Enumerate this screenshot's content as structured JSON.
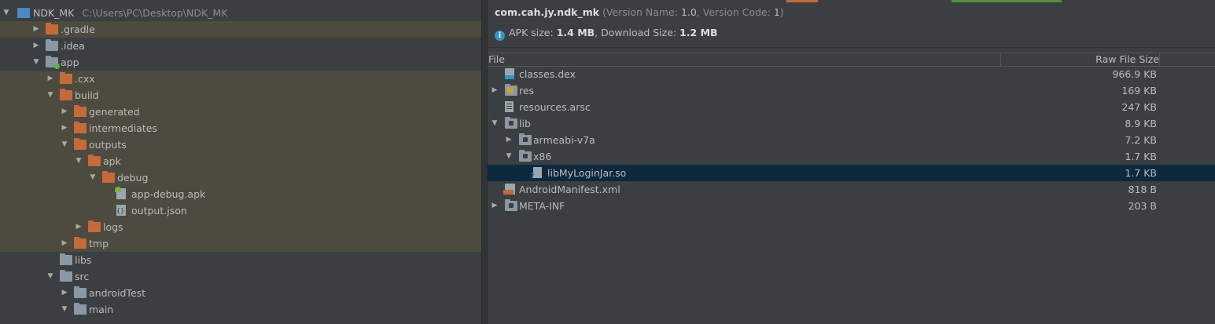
{
  "project_tree": {
    "root": {
      "name": "NDK_MK",
      "path": "C:\\Users\\PC\\Desktop\\NDK_MK"
    },
    "items": [
      {
        "label": ".gradle",
        "depth": 1,
        "arrow": "collapsed",
        "icon": "folder-orange-icon",
        "excluded": true
      },
      {
        "label": ".idea",
        "depth": 1,
        "arrow": "collapsed",
        "icon": "folder-gray-icon",
        "excluded": false
      },
      {
        "label": "app",
        "depth": 1,
        "arrow": "expanded",
        "icon": "module-folder-icon",
        "excluded": false
      },
      {
        "label": ".cxx",
        "depth": 2,
        "arrow": "collapsed",
        "icon": "folder-orange-icon",
        "excluded": true
      },
      {
        "label": "build",
        "depth": 2,
        "arrow": "expanded",
        "icon": "folder-orange-icon",
        "excluded": true
      },
      {
        "label": "generated",
        "depth": 3,
        "arrow": "collapsed",
        "icon": "folder-orange-icon",
        "excluded": true
      },
      {
        "label": "intermediates",
        "depth": 3,
        "arrow": "collapsed",
        "icon": "folder-orange-icon",
        "excluded": true
      },
      {
        "label": "outputs",
        "depth": 3,
        "arrow": "expanded",
        "icon": "folder-orange-icon",
        "excluded": true
      },
      {
        "label": "apk",
        "depth": 4,
        "arrow": "expanded",
        "icon": "folder-orange-icon",
        "excluded": true
      },
      {
        "label": "debug",
        "depth": 5,
        "arrow": "expanded",
        "icon": "folder-orange-icon",
        "excluded": true
      },
      {
        "label": "app-debug.apk",
        "depth": 6,
        "arrow": "none",
        "icon": "apk-file-icon",
        "excluded": true
      },
      {
        "label": "output.json",
        "depth": 6,
        "arrow": "none",
        "icon": "json-file-icon",
        "excluded": true
      },
      {
        "label": "logs",
        "depth": 4,
        "arrow": "collapsed",
        "icon": "folder-orange-icon",
        "excluded": true
      },
      {
        "label": "tmp",
        "depth": 3,
        "arrow": "collapsed",
        "icon": "folder-orange-icon",
        "excluded": true
      },
      {
        "label": "libs",
        "depth": 2,
        "arrow": "none",
        "icon": "folder-gray-icon",
        "excluded": false
      },
      {
        "label": "src",
        "depth": 2,
        "arrow": "expanded",
        "icon": "folder-gray-icon",
        "excluded": false
      },
      {
        "label": "androidTest",
        "depth": 3,
        "arrow": "collapsed",
        "icon": "folder-gray-icon",
        "excluded": false
      },
      {
        "label": "main",
        "depth": 3,
        "arrow": "expanded",
        "icon": "folder-gray-icon",
        "excluded": false
      }
    ]
  },
  "apk_analyzer": {
    "package": "com.cah.jy.ndk_mk",
    "version_name_label": "Version Name:",
    "version_name": "1.0",
    "version_code_label": "Version Code:",
    "version_code": "1",
    "apk_size_label": "APK size:",
    "apk_size": "1.4 MB",
    "download_size_label": "Download Size:",
    "download_size": "1.2 MB",
    "columns": {
      "file": "File",
      "raw_size": "Raw File Size"
    },
    "files": [
      {
        "name": "classes.dex",
        "size": "966.9 KB",
        "depth": 0,
        "arrow": "none",
        "icon": "dex-file-icon",
        "selected": false
      },
      {
        "name": "res",
        "size": "169 KB",
        "depth": 0,
        "arrow": "collapsed",
        "icon": "res-folder-icon",
        "selected": false
      },
      {
        "name": "resources.arsc",
        "size": "247 KB",
        "depth": 0,
        "arrow": "none",
        "icon": "file-icon",
        "selected": false
      },
      {
        "name": "lib",
        "size": "8.9 KB",
        "depth": 0,
        "arrow": "expanded",
        "icon": "lib-folder-icon",
        "selected": false
      },
      {
        "name": "armeabi-v7a",
        "size": "7.2 KB",
        "depth": 1,
        "arrow": "collapsed",
        "icon": "lib-folder-icon",
        "selected": false
      },
      {
        "name": "x86",
        "size": "1.7 KB",
        "depth": 1,
        "arrow": "expanded",
        "icon": "lib-folder-icon",
        "selected": false
      },
      {
        "name": "libMyLoginJar.so",
        "size": "1.7 KB",
        "depth": 2,
        "arrow": "none",
        "icon": "unknown-file-icon",
        "selected": true
      },
      {
        "name": "AndroidManifest.xml",
        "size": "818 B",
        "depth": 0,
        "arrow": "none",
        "icon": "xml-file-icon",
        "selected": false
      },
      {
        "name": "META-INF",
        "size": "203 B",
        "depth": 0,
        "arrow": "collapsed",
        "icon": "lib-folder-icon",
        "selected": false
      }
    ]
  },
  "colors": {
    "panel_bg": "#3c3f41",
    "excluded_bg": "#4d4a3f",
    "selection_bg": "#0d293e",
    "folder_orange": "#c56a3b",
    "folder_gray": "#8b98a3",
    "info_blue": "#3592c4"
  }
}
